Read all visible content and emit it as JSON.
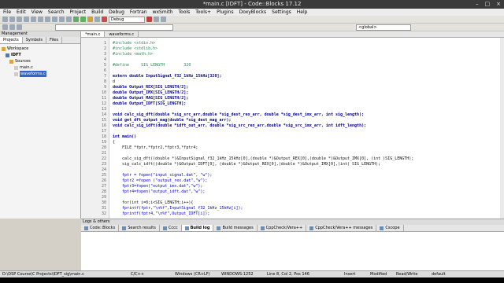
{
  "window": {
    "title": "*main.c [IDFT] - Code::Blocks 17.12"
  },
  "menu": [
    "File",
    "Edit",
    "View",
    "Search",
    "Project",
    "Build",
    "Debug",
    "Fortran",
    "wxSmith",
    "Tools",
    "Tools+",
    "Plugins",
    "DoxyBlocks",
    "Settings",
    "Help"
  ],
  "toolbar": {
    "build_target": "Debug",
    "scope": "<global>"
  },
  "management": {
    "title": "Management",
    "tabs": [
      "Projects",
      "Symbols",
      "Files"
    ],
    "tree": [
      "Workspace",
      "IDFT",
      "Sources",
      "main.c",
      "waveforms.c"
    ]
  },
  "editor": {
    "tabs": [
      "*main.c",
      "waveforms.c"
    ],
    "lines": [
      {
        "n": "1",
        "t": "#include <stdio.h>",
        "c": "pp"
      },
      {
        "n": "2",
        "t": "#include <stdlib.h>",
        "c": "pp"
      },
      {
        "n": "3",
        "t": "#include <math.h>",
        "c": "pp"
      },
      {
        "n": "4",
        "t": "",
        "c": ""
      },
      {
        "n": "5",
        "t": "#define     SIG_LENGTH        320",
        "c": "pp"
      },
      {
        "n": "6",
        "t": "",
        "c": ""
      },
      {
        "n": "7",
        "t": "extern double InputSignal_f32_1kHz_15kHz[320];",
        "c": "kw"
      },
      {
        "n": "8",
        "t": "d",
        "c": ""
      },
      {
        "n": "9",
        "t": "double Output_REX[SIG_LENGTH/2];",
        "c": "kw"
      },
      {
        "n": "10",
        "t": "double Output_IMX[SIG_LENGTH/2];",
        "c": "kw"
      },
      {
        "n": "11",
        "t": "double Output_MAG[SIG_LENGTH/2];",
        "c": "kw"
      },
      {
        "n": "12",
        "t": "double Output_IDFT[SIG_LENGTH];",
        "c": "kw"
      },
      {
        "n": "13",
        "t": "",
        "c": ""
      },
      {
        "n": "14",
        "t": "void calc_sig_dft(double *sig_src_arr,double *sig_dest_rex_arr, double *sig_dest_imx_arr, int sig_length);",
        "c": "kw"
      },
      {
        "n": "15",
        "t": "void get_dft_output_mag(double *sig_dest_mag_arr);",
        "c": "kw"
      },
      {
        "n": "16",
        "t": "void calc_sig_idft(double *idft_out_arr, double *sig_src_rex_arr,double *sig_src_imx_arr, int idft_length);",
        "c": "kw"
      },
      {
        "n": "17",
        "t": "",
        "c": ""
      },
      {
        "n": "18",
        "t": "int main()",
        "c": "kw"
      },
      {
        "n": "19",
        "t": "{",
        "c": ""
      },
      {
        "n": "20",
        "t": "    FILE *fptr,*fptr2,*fptr3,*fptr4;",
        "c": ""
      },
      {
        "n": "21",
        "t": "",
        "c": ""
      },
      {
        "n": "22",
        "t": "    calc_sig_dft((double *)&InputSignal_f32_1kHz_15kHz[0],(double *)&Output_REX[0],(double *)&Output_IMX[0], (int )SIG_LENGTH);",
        "c": ""
      },
      {
        "n": "23",
        "t": "    sig_calc_idft((double *)&Output_IDFT[0], (double *)&Output_REX[0],(double *)&Output_IMX[0],(int) SIG_LENGTH);",
        "c": ""
      },
      {
        "n": "24",
        "t": "",
        "c": ""
      },
      {
        "n": "25",
        "t": "    fptr = fopen(\"input_signal.dat\", \"w\");",
        "c": "str"
      },
      {
        "n": "26",
        "t": "    fptr2 =fopen (\"output_rex.dat\",\"w\");",
        "c": "str"
      },
      {
        "n": "27",
        "t": "    fptr3=fopen(\"output_imx.dat\",\"w\");",
        "c": "str"
      },
      {
        "n": "28",
        "t": "    fptr4=fopen(\"output_idft.dat\",\"w\");",
        "c": "str"
      },
      {
        "n": "29",
        "t": "",
        "c": ""
      },
      {
        "n": "30",
        "t": "    for(int i=0;i<SIG_LENGTH;i++){",
        "c": ""
      },
      {
        "n": "31",
        "t": "    fprintf(fptr,\"\\n%f\",InputSignal_f32_1kHz_15kHz[i]);",
        "c": "str"
      },
      {
        "n": "32",
        "t": "    fprintf(fptr4,\"\\n%f\",Output_IDFT[i]);",
        "c": "str"
      }
    ]
  },
  "logs": {
    "title": "Logs & others",
    "tabs": [
      "Code::Blocks",
      "Search results",
      "Cccc",
      "Build log",
      "Build messages",
      "CppCheck/Vera++",
      "CppCheck/Vera++ messages",
      "Cscope"
    ]
  },
  "status": {
    "path": "D:\\DSP Course\\C Projects\\IDFT_sig\\main.c",
    "lang": "C/C++",
    "eol": "Windows (CR+LF)",
    "enc": "WINDOWS-1252",
    "pos": "Line 8, Col 2, Pos 146",
    "mode": "Insert",
    "mod": "Modified",
    "rw": "Read/Write",
    "profile": "default"
  }
}
